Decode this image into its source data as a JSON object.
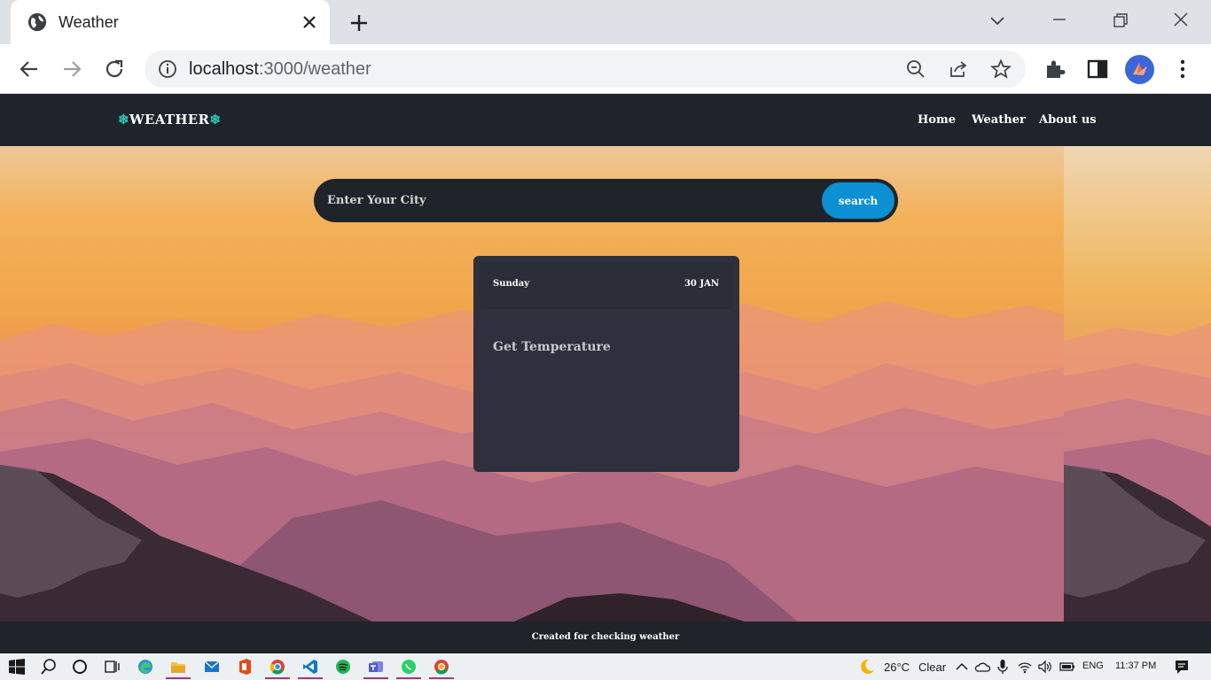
{
  "browser": {
    "tab_title": "Weather",
    "url_host": "localhost",
    "url_path": ":3000/weather"
  },
  "site": {
    "brand_flake": "❄",
    "brand_text": "WEATHER",
    "nav": [
      "Home",
      "Weather",
      "About us"
    ]
  },
  "search": {
    "placeholder": "Enter Your City",
    "button_label": "search"
  },
  "card": {
    "day": "Sunday",
    "date": "30 JAN",
    "temperature_text": "Get Temperature"
  },
  "footer": {
    "text": "Created for checking weather"
  },
  "taskbar": {
    "weather_temp": "26°C",
    "weather_desc": "Clear",
    "language": "ENG",
    "time": "11:37 PM"
  },
  "colors": {
    "navbar": "#1e2429",
    "search_button": "#0d8fd3",
    "card": "#2e313d",
    "accent_flake": "#2ec4b6"
  }
}
